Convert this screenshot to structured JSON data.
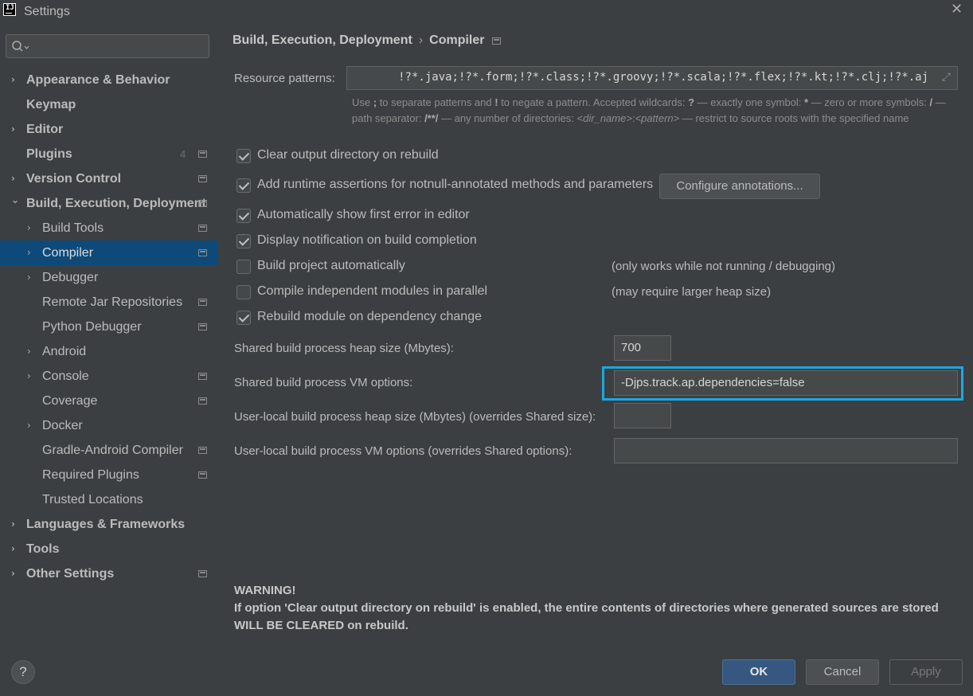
{
  "window": {
    "title": "Settings",
    "close_glyph": "✕"
  },
  "search": {
    "placeholder": ""
  },
  "sidebar": {
    "items": [
      {
        "label": "Appearance & Behavior",
        "top": true,
        "chevron": "›"
      },
      {
        "label": "Keymap",
        "top": true
      },
      {
        "label": "Editor",
        "top": true,
        "chevron": "›"
      },
      {
        "label": "Plugins",
        "top": true,
        "badge": "4"
      },
      {
        "label": "Version Control",
        "top": true,
        "chevron": "›"
      },
      {
        "label": "Build, Execution, Deployment",
        "top": true,
        "chevron": "⌄"
      },
      {
        "label": "Build Tools",
        "chevron": "›"
      },
      {
        "label": "Compiler",
        "chevron": "›",
        "selected": true
      },
      {
        "label": "Debugger",
        "chevron": "›"
      },
      {
        "label": "Remote Jar Repositories"
      },
      {
        "label": "Python Debugger"
      },
      {
        "label": "Android",
        "chevron": "›"
      },
      {
        "label": "Console",
        "chevron": "›"
      },
      {
        "label": "Coverage"
      },
      {
        "label": "Docker",
        "chevron": "›"
      },
      {
        "label": "Gradle-Android Compiler"
      },
      {
        "label": "Required Plugins"
      },
      {
        "label": "Trusted Locations"
      },
      {
        "label": "Languages & Frameworks",
        "top": true,
        "chevron": "›"
      },
      {
        "label": "Tools",
        "top": true,
        "chevron": "›"
      },
      {
        "label": "Other Settings",
        "top": true,
        "chevron": "›"
      }
    ]
  },
  "breadcrumb": {
    "parent": "Build, Execution, Deployment",
    "separator": "›",
    "current": "Compiler"
  },
  "resource": {
    "label": "Resource patterns:",
    "value": "!?*.java;!?*.form;!?*.class;!?*.groovy;!?*.scala;!?*.flex;!?*.kt;!?*.clj;!?*.aj",
    "expand_glyph": "⤢"
  },
  "help": {
    "t1": "Use ",
    "b1": ";",
    "t2": " to separate patterns and ",
    "b2": "!",
    "t3": " to negate a pattern. Accepted wildcards: ",
    "b3": "?",
    "t4": " — exactly one symbol: ",
    "b4": "*",
    "t5": " — zero or more symbols: ",
    "b5": "/",
    "t6": " — path separator: ",
    "b6": "/**/",
    "t7": " — any number of directories: ",
    "i1": "<dir_name>",
    "t8": ":",
    "i2": "<pattern>",
    "t9": " — restrict to source roots with the specified name"
  },
  "options": {
    "clear_output": "Clear output directory on rebuild",
    "runtime_assertions": "Add runtime assertions for notnull-annotated methods and parameters",
    "configure_annotations": "Configure annotations...",
    "show_first_error": "Automatically show first error in editor",
    "display_notification": "Display notification on build completion",
    "build_auto": "Build project automatically",
    "build_auto_note": "(only works while not running / debugging)",
    "parallel": "Compile independent modules in parallel",
    "parallel_note": "(may require larger heap size)",
    "rebuild_dep": "Rebuild module on dependency change"
  },
  "fields": {
    "shared_heap_label": "Shared build process heap size (Mbytes):",
    "shared_heap_value": "700",
    "shared_vm_label": "Shared build process VM options:",
    "shared_vm_value": "-Djps.track.ap.dependencies=false",
    "user_heap_label": "User-local build process heap size (Mbytes) (overrides Shared size):",
    "user_heap_value": "",
    "user_vm_label": "User-local build process VM options (overrides Shared options):",
    "user_vm_value": ""
  },
  "warning": {
    "title": "WARNING!",
    "body": "If option 'Clear output directory on rebuild' is enabled, the entire contents of directories where generated sources are stored WILL BE CLEARED on rebuild."
  },
  "buttons": {
    "ok": "OK",
    "cancel": "Cancel",
    "apply": "Apply",
    "help": "?"
  },
  "colors": {
    "background": "#3c3f41",
    "selection": "#0d4a7a",
    "highlight_box": "#1aa7e0",
    "ok_button": "#365880"
  }
}
